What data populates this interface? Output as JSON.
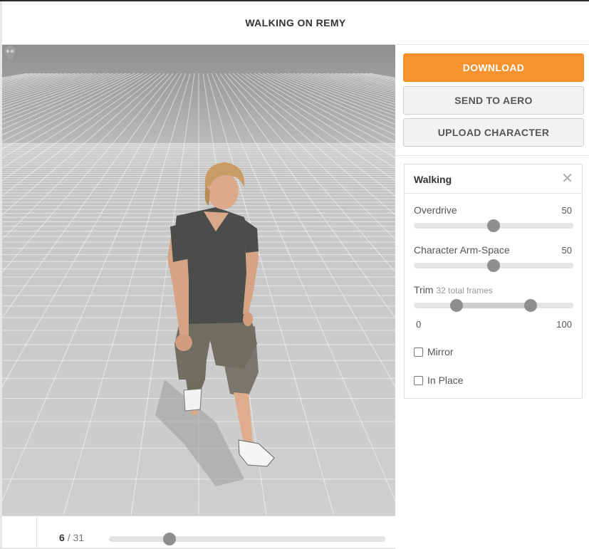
{
  "header": {
    "title": "WALKING ON REMY"
  },
  "actions": {
    "download": "DOWNLOAD",
    "send_to_aero": "SEND TO AERO",
    "upload_character": "UPLOAD CHARACTER"
  },
  "colors": {
    "accent": "#f7922e",
    "thumb": "#8f8f8f"
  },
  "animation_panel": {
    "title": "Walking",
    "close_icon": "close-icon",
    "overdrive": {
      "label": "Overdrive",
      "value": "50",
      "fraction": 0.5
    },
    "arm_space": {
      "label": "Character Arm-Space",
      "value": "50",
      "fraction": 0.5
    },
    "trim": {
      "label": "Trim",
      "sub": "32 total frames",
      "min_label": "0",
      "max_label": "100",
      "start_fraction": 0.27,
      "end_fraction": 0.73
    },
    "mirror": {
      "label": "Mirror",
      "checked": false
    },
    "in_place": {
      "label": "In Place",
      "checked": false
    }
  },
  "timeline": {
    "current": "6",
    "separator": "/",
    "total": "31",
    "fraction": 0.22
  },
  "viewport": {
    "skull_icon": "skull-icon"
  }
}
